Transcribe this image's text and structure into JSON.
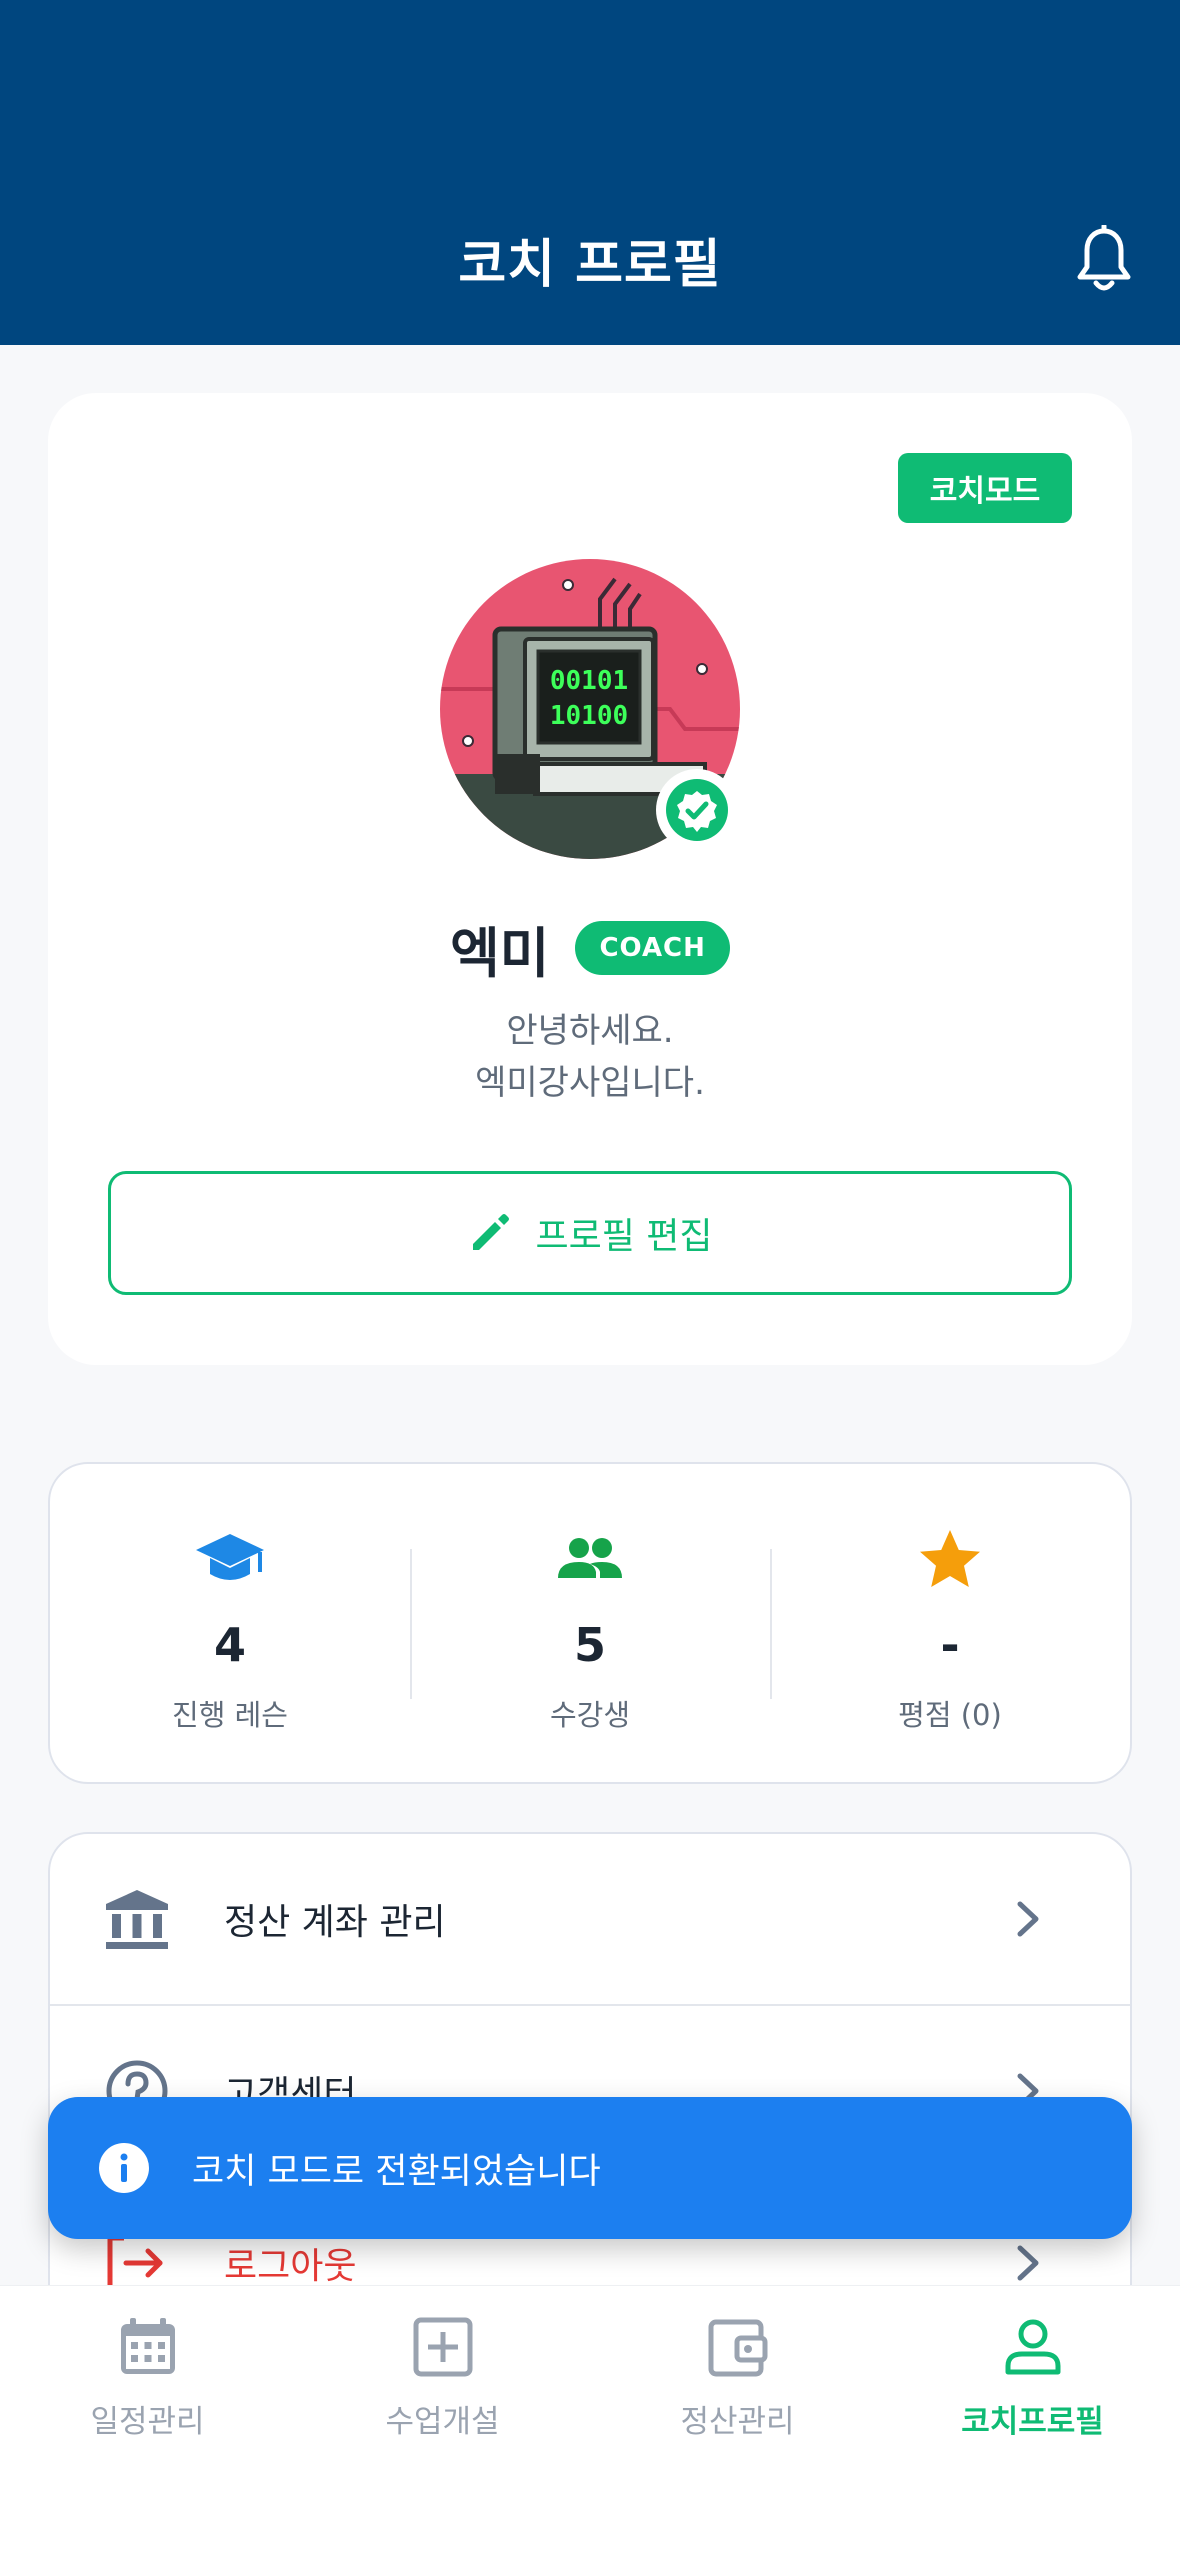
{
  "header": {
    "title": "코치 프로필",
    "bell_icon": "bell-icon"
  },
  "profile": {
    "mode_badge": "코치모드",
    "name": "엑미",
    "role_badge": "COACH",
    "bio_line1": "안녕하세요.",
    "bio_line2": "엑미강사입니다.",
    "edit_label": "프로필 편집",
    "avatar_screen_line1": "00101",
    "avatar_screen_line2": "10100"
  },
  "stats": [
    {
      "icon": "graduation-cap-icon",
      "value": "4",
      "label": "진행 레슨",
      "color": "#1e88e5"
    },
    {
      "icon": "people-icon",
      "value": "5",
      "label": "수강생",
      "color": "#16a34a"
    },
    {
      "icon": "star-icon",
      "value": "-",
      "label": "평점 (0)",
      "color": "#f59e0b"
    }
  ],
  "menu": [
    {
      "icon": "bank-icon",
      "label": "정산 계좌 관리"
    },
    {
      "icon": "help-circle-icon",
      "label": "고객센터"
    },
    {
      "icon": "logout-icon",
      "label": "로그아웃"
    }
  ],
  "toast": {
    "icon": "info-icon",
    "message": "코치 모드로 전환되었습니다"
  },
  "nav": [
    {
      "icon": "calendar-icon",
      "label": "일정관리",
      "active": false
    },
    {
      "icon": "plus-square-icon",
      "label": "수업개설",
      "active": false
    },
    {
      "icon": "wallet-icon",
      "label": "정산관리",
      "active": false
    },
    {
      "icon": "user-icon",
      "label": "코치프로필",
      "active": true
    }
  ],
  "colors": {
    "header": "#00467f",
    "accent": "#0fbb74",
    "toast": "#1c7ff0",
    "logout": "#e53935"
  }
}
